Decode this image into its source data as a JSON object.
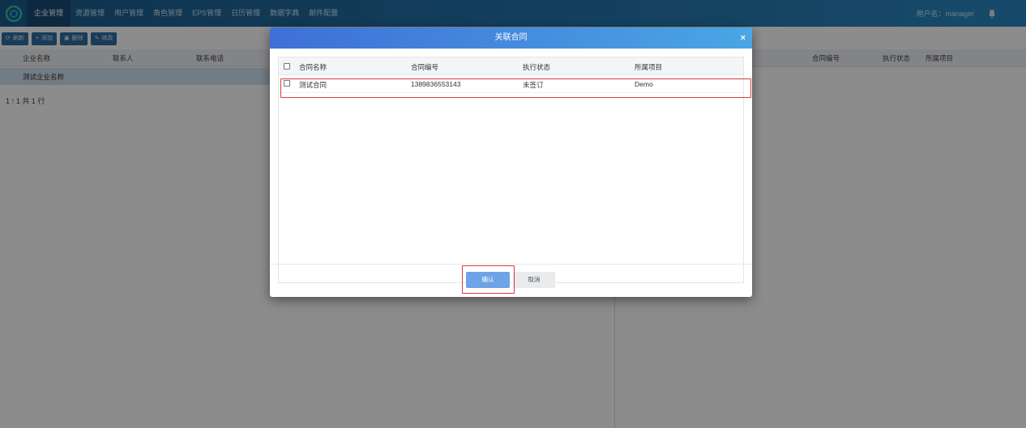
{
  "nav": {
    "items": [
      "企业管理",
      "资源管理",
      "用户管理",
      "角色管理",
      "EPS管理",
      "日历管理",
      "数据字典",
      "邮件配置"
    ],
    "user": "用户名：manager"
  },
  "toolbar": {
    "refresh": "刷新",
    "add": "添加",
    "delete": "删除",
    "edit": "修改"
  },
  "left_grid": {
    "columns": [
      "企业名称",
      "联系人",
      "联系电话"
    ],
    "rows": [
      [
        "测试企业名称",
        "",
        ""
      ]
    ],
    "pager": "1 ⁝ 1 共 1 行"
  },
  "right_grid": {
    "columns": [
      "合同编号",
      "执行状态",
      "所属项目"
    ]
  },
  "modal": {
    "title": "关联合同",
    "close": "×",
    "columns": [
      "合同名称",
      "合同编号",
      "执行状态",
      "所属项目"
    ],
    "rows": [
      {
        "name": "测试合同",
        "code": "1389836553143",
        "status": "未签订",
        "project": "Demo"
      }
    ],
    "confirm": "确认",
    "cancel": "取消"
  },
  "colors": {
    "nav_bg": "#2b88c2",
    "modal_head": "#3f6fd6",
    "highlight": "#e03a3a"
  }
}
